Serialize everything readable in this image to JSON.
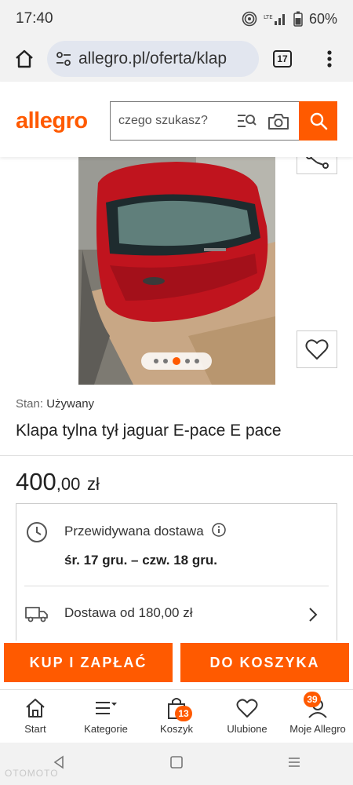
{
  "status": {
    "time": "17:40",
    "battery": "60%"
  },
  "browser": {
    "url": "allegro.pl/oferta/klap",
    "tabs_count": "17"
  },
  "header": {
    "logo": "allegro",
    "search_placeholder": "czego szukasz?"
  },
  "gallery": {
    "image_count": 5,
    "active_index": 2
  },
  "offer": {
    "condition_label": "Stan:",
    "condition_value": "Używany",
    "title": "Klapa tylna tył jaguar E-pace E pace",
    "price_whole": "400",
    "price_cents": ",00",
    "currency": "zł"
  },
  "delivery": {
    "estimated_label": "Przewidywana dostawa",
    "dates": "śr. 17 gru. – czw. 18 gru.",
    "cost_label": "Dostawa od 180,00 zł"
  },
  "actions": {
    "buy": "KUP I ZAPŁAĆ",
    "add_to_cart": "DO KOSZYKA"
  },
  "nav": {
    "items": [
      {
        "label": "Start"
      },
      {
        "label": "Kategorie"
      },
      {
        "label": "Koszyk",
        "badge": "13"
      },
      {
        "label": "Ulubione"
      },
      {
        "label": "Moje Allegro",
        "badge": "39"
      }
    ]
  },
  "watermark": "OTOMOTO",
  "colors": {
    "accent": "#ff5a00"
  }
}
